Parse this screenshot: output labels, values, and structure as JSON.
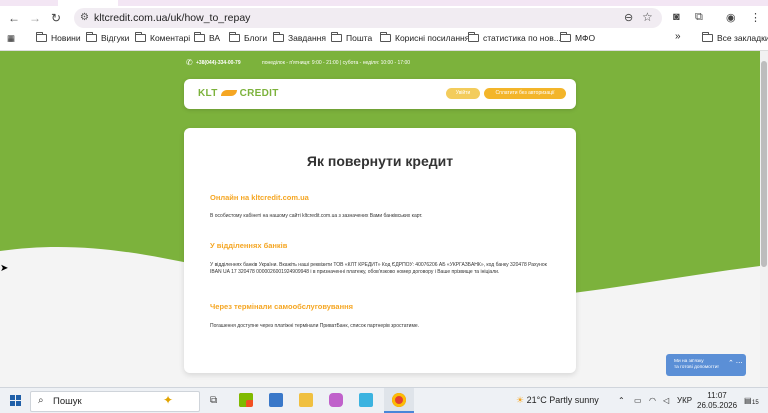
{
  "browser": {
    "url": "kltcredit.com.ua/uk/how_to_repay",
    "bookmarks": [
      "Новини",
      "Відгуки",
      "Коментарі",
      "ВА",
      "Блоги",
      "Завдання",
      "Пошта",
      "Корисні посилання",
      "статистика по нов...",
      "МФО"
    ],
    "all_bookmarks": "Все закладки",
    "more": "»"
  },
  "site": {
    "phone": "+38(044)-334-00-79",
    "hours": "понеділок - п'ятниця: 9:00 - 21:00 | субота - неділя: 10:00 - 17:00",
    "logo_left": "KLT",
    "logo_right": "CREDIT",
    "login_button": "Увійти",
    "pay_button": "Сплатити без авторизації",
    "title": "Як повернути кредит",
    "sections": [
      {
        "heading": "Онлайн на kltcredit.com.ua",
        "text": "В особистому кабінеті на нашому сайті kltcredit.com.ua з зазначених Вами банківських карт."
      },
      {
        "heading": "У відділеннях банків",
        "text": "У відділеннях банків України. Вкажіть наші реквізити ТОВ «КЛТ КРЕДИТ» Код ЄДРПОУ: 40076206 АБ «УКРГАЗБАНК», код банку 320478 Рахунок IBAN UA 17 320478 0000026001924909948 і в призначенні платежу, обов'язково номер договору і Ваше прізвище та ініціали."
      },
      {
        "heading": "Через термінали самообслуговування",
        "text": "Погашення доступне через платіжні термінали ПриватБанк, список партнерів зростатиме."
      }
    ],
    "chat_line1": "Ми на зв'язку",
    "chat_line2": "та готові допомогти!"
  },
  "taskbar": {
    "search": "Пошук",
    "weather_temp": "21°C",
    "weather_text": "Partly sunny",
    "lang": "УКР",
    "time": "11:07",
    "date": "26.05.2026",
    "notif_count": "15"
  }
}
